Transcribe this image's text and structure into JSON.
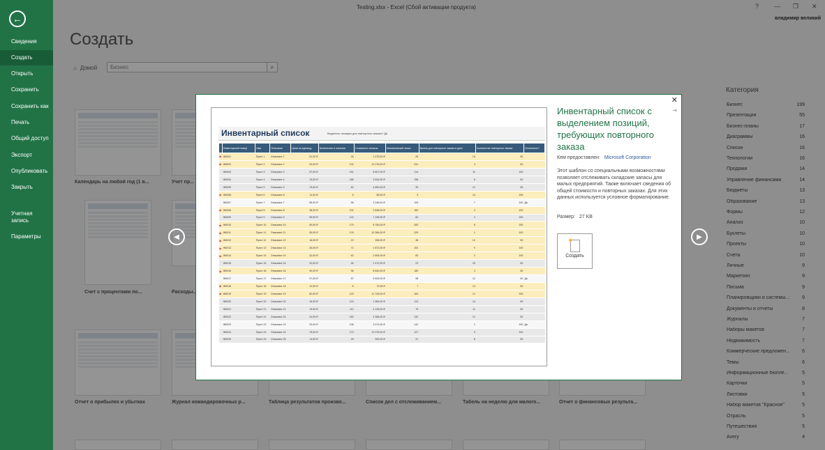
{
  "window": {
    "title": "Testing.xlsx - Excel (Сбой активации продукта)",
    "help": "?",
    "minimize": "—",
    "restore": "❐",
    "close": "✕",
    "user": "владимир великий"
  },
  "sidebar": {
    "back_icon": "←",
    "items": [
      {
        "label": "Сведения"
      },
      {
        "label": "Создать"
      },
      {
        "label": "Открыть"
      },
      {
        "label": "Сохранить"
      },
      {
        "label": "Сохранить как"
      },
      {
        "label": "Печать"
      },
      {
        "label": "Общий доступ"
      },
      {
        "label": "Экспорт"
      },
      {
        "label": "Опубликовать"
      },
      {
        "label": "Закрыть"
      },
      {
        "label": "Учетная запись"
      },
      {
        "label": "Параметры"
      }
    ],
    "active": "Создать",
    "color": "#217346"
  },
  "main": {
    "title": "Создать",
    "home": "Домой",
    "search_value": "Бизнес",
    "thumbs": [
      {
        "label": "Календарь на любой год (1 в..."
      },
      {
        "label": "Учет пр..."
      },
      {
        "label": "Счет с процентами по..."
      },
      {
        "label": "Расходы..."
      },
      {
        "label": "Отчет о прибылях и убытках"
      },
      {
        "label": "Журнал командировочных р..."
      },
      {
        "label": "Таблица результатов произво..."
      },
      {
        "label": "Список дел с отслеживанием..."
      },
      {
        "label": "Табель на неделю для малого..."
      },
      {
        "label": "Отчет о финансовых результа..."
      }
    ]
  },
  "categories": {
    "title": "Категория",
    "items": [
      {
        "name": "Бизнес",
        "count": "199"
      },
      {
        "name": "Презентации",
        "count": "55"
      },
      {
        "name": "Бизнес-планы",
        "count": "17"
      },
      {
        "name": "Диаграммы",
        "count": "16"
      },
      {
        "name": "Списки",
        "count": "16"
      },
      {
        "name": "Технологии",
        "count": "16"
      },
      {
        "name": "Продажи",
        "count": "14"
      },
      {
        "name": "Управление финансами",
        "count": "14"
      },
      {
        "name": "Бюджеты",
        "count": "13"
      },
      {
        "name": "Образование",
        "count": "13"
      },
      {
        "name": "Формы",
        "count": "12"
      },
      {
        "name": "Анализ",
        "count": "10"
      },
      {
        "name": "Буклеты",
        "count": "10"
      },
      {
        "name": "Проекты",
        "count": "10"
      },
      {
        "name": "Счета",
        "count": "10"
      },
      {
        "name": "Личные",
        "count": "9"
      },
      {
        "name": "Маркетинг",
        "count": "9"
      },
      {
        "name": "Письма",
        "count": "9"
      },
      {
        "name": "Планировщики и системы...",
        "count": "9"
      },
      {
        "name": "Документы и отчеты",
        "count": "8"
      },
      {
        "name": "Журналы",
        "count": "7"
      },
      {
        "name": "Наборы макетов",
        "count": "7"
      },
      {
        "name": "Недвижимость",
        "count": "7"
      },
      {
        "name": "Коммерческие предложен...",
        "count": "6"
      },
      {
        "name": "Темы",
        "count": "6"
      },
      {
        "name": "Информационные бюлле...",
        "count": "5"
      },
      {
        "name": "Карточки",
        "count": "5"
      },
      {
        "name": "Листовки",
        "count": "5"
      },
      {
        "name": "Набор макетов \"Красное\"",
        "count": "5"
      },
      {
        "name": "Отрасль",
        "count": "5"
      },
      {
        "name": "Путешествия",
        "count": "5"
      },
      {
        "name": "Avery",
        "count": "4"
      }
    ]
  },
  "modal": {
    "close": "✕",
    "pin": "⇥",
    "title": "Инвентарный список с выделением позиций, требующих повторного заказа",
    "provider_label": "Кем предоставлен:",
    "provider": "Microsoft Corporation",
    "description": "Этот шаблон со специальными возможностями позволяет отслеживать складские запасы для малых предприятий. Также включает сведения об общей стоимости и повторных заказах. Для этих данных используется условное форматирование.",
    "size_label": "Размер:",
    "size": "27 KB",
    "create": "Создать",
    "prev": "◀",
    "next": "▶",
    "preview": {
      "title": "Инвентарный список",
      "hint": "Выделить позиции для повторного заказа?  Да",
      "headers": [
        "Инвентарный номер",
        "Имя",
        "Описание",
        "Цена за единицу",
        "Количество в наличии",
        "Стоимость запасов",
        "Минимальный запас",
        "Время для повторного заказа в днях",
        "Количество повторного заказа",
        "Отключено?"
      ],
      "rows": [
        [
          "IN0001",
          "Пункт 1",
          "Описание 1",
          "51,00 ₽",
          "25",
          "1 275,00 ₽",
          "29",
          "13",
          "50",
          "",
          "hl"
        ],
        [
          "IN0002",
          "Пункт 2",
          "Описание 2",
          "93,00 ₽",
          "132",
          "12 276,00 ₽",
          "231",
          "4",
          "50",
          "",
          "hl"
        ],
        [
          "IN0003",
          "Пункт 3",
          "Описание 3",
          "57,00 ₽",
          "151",
          "8 607,00 ₽",
          "114",
          "11",
          "150",
          "",
          "gr"
        ],
        [
          "IN0004",
          "Пункт 4",
          "Описание 4",
          "19,00 ₽",
          "186",
          "3 534,00 ₽",
          "158",
          "6",
          "50",
          "",
          "gr"
        ],
        [
          "IN0005",
          "Пункт 5",
          "Описание 5",
          "75,00 ₽",
          "62",
          "4 650,00 ₽",
          "39",
          "12",
          "50",
          "",
          "gr"
        ],
        [
          "IN0006",
          "Пункт 6",
          "Описание 6",
          "11,00 ₽",
          "5",
          "55,00 ₽",
          "9",
          "13",
          "150",
          "",
          "hl"
        ],
        [
          "IN0007",
          "Пункт 7",
          "Описание 7",
          "56,00 ₽",
          "58",
          "3 248,00 ₽",
          "109",
          "7",
          "100",
          "Да",
          "wt"
        ],
        [
          "IN0008",
          "Пункт 8",
          "Описание 8",
          "38,00 ₽",
          "101",
          "3 838,00 ₽",
          "162",
          "3",
          "100",
          "",
          "hl"
        ],
        [
          "IN0009",
          "Пункт 9",
          "Описание 9",
          "59,00 ₽",
          "122",
          "7 198,00 ₽",
          "82",
          "3",
          "150",
          "",
          "gr"
        ],
        [
          "IN0010",
          "Пункт 10",
          "Описание 10",
          "50,00 ₽",
          "175",
          "8 750,00 ₽",
          "283",
          "8",
          "150",
          "",
          "hl"
        ],
        [
          "IN0011",
          "Пункт 11",
          "Описание 11",
          "59,00 ₽",
          "176",
          "10 384,00 ₽",
          "229",
          "1",
          "100",
          "",
          "hl"
        ],
        [
          "IN0012",
          "Пункт 12",
          "Описание 12",
          "18,00 ₽",
          "22",
          "396,00 ₽",
          "36",
          "12",
          "50",
          "",
          "hl"
        ],
        [
          "IN0013",
          "Пункт 13",
          "Описание 13",
          "26,00 ₽",
          "72",
          "1 872,00 ₽",
          "102",
          "9",
          "100",
          "",
          "hl"
        ],
        [
          "IN0014",
          "Пункт 14",
          "Описание 14",
          "42,00 ₽",
          "62",
          "2 604,00 ₽",
          "83",
          "2",
          "100",
          "",
          "hl"
        ],
        [
          "IN0015",
          "Пункт 15",
          "Описание 15",
          "32,00 ₽",
          "46",
          "1 472,00 ₽",
          "23",
          "15",
          "50",
          "",
          "gr"
        ],
        [
          "IN0016",
          "Пункт 16",
          "Описание 16",
          "90,00 ₽",
          "96",
          "8 640,00 ₽",
          "180",
          "3",
          "50",
          "",
          "hl"
        ],
        [
          "IN0017",
          "Пункт 17",
          "Описание 17",
          "97,00 ₽",
          "57",
          "5 529,00 ₽",
          "98",
          "12",
          "50",
          "Да",
          "wt"
        ],
        [
          "IN0018",
          "Пункт 18",
          "Описание 18",
          "12,00 ₽",
          "6",
          "72,00 ₽",
          "7",
          "13",
          "50",
          "",
          "hl"
        ],
        [
          "IN0019",
          "Пункт 19",
          "Описание 19",
          "82,00 ₽",
          "143",
          "11 726,00 ₽",
          "164",
          "12",
          "150",
          "",
          "hl"
        ],
        [
          "IN0020",
          "Пункт 20",
          "Описание 20",
          "16,00 ₽",
          "124",
          "1 984,00 ₽",
          "113",
          "14",
          "50",
          "",
          "gr"
        ],
        [
          "IN0021",
          "Пункт 21",
          "Описание 21",
          "19,00 ₽",
          "112",
          "2 128,00 ₽",
          "75",
          "11",
          "50",
          "",
          "gr"
        ],
        [
          "IN0022",
          "Пункт 22",
          "Описание 22",
          "24,00 ₽",
          "182",
          "4 368,00 ₽",
          "132",
          "12",
          "50",
          "",
          "gr"
        ],
        [
          "IN0023",
          "Пункт 23",
          "Описание 23",
          "29,00 ₽",
          "106",
          "3 074,00 ₽",
          "142",
          "1",
          "150",
          "Да",
          "wt"
        ],
        [
          "IN0024",
          "Пункт 24",
          "Описание 24",
          "75,00 ₽",
          "173",
          "12 975,00 ₽",
          "127",
          "9",
          "100",
          "",
          "gr"
        ],
        [
          "IN0025",
          "Пункт 25",
          "Описание 25",
          "14,00 ₽",
          "28",
          "392,00 ₽",
          "21",
          "8",
          "50",
          "",
          "gr"
        ]
      ]
    }
  }
}
